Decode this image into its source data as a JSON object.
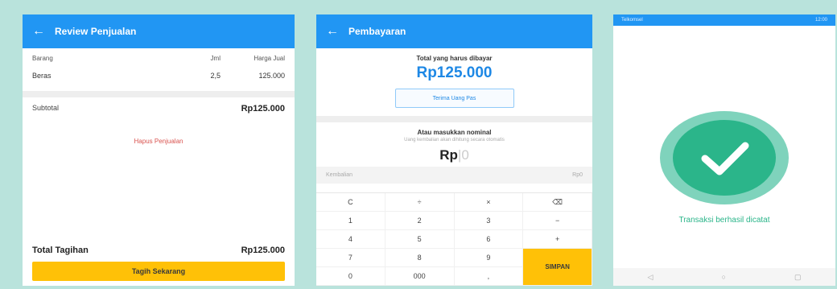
{
  "screen1": {
    "title": "Review Penjualan",
    "headers": {
      "item": "Barang",
      "qty": "Jml",
      "price": "Harga Jual"
    },
    "rows": [
      {
        "item": "Beras",
        "qty": "2,5",
        "price": "125.000"
      }
    ],
    "subtotal_label": "Subtotal",
    "subtotal_value": "Rp125.000",
    "delete_label": "Hapus Penjualan",
    "total_label": "Total Tagihan",
    "total_value": "Rp125.000",
    "charge_button": "Tagih Sekarang"
  },
  "screen2": {
    "title": "Pembayaran",
    "total_label": "Total yang harus dibayar",
    "total_value": "Rp125.000",
    "exact_cash_button": "Terima Uang Pas",
    "nominal_title": "Atau masukkan nominal",
    "nominal_hint": "Uang kembalian akan dihitung secara otomatis",
    "input_prefix": "Rp",
    "input_placeholder": "0",
    "change_label": "Kembalian",
    "change_value": "Rp0",
    "keys": [
      "C",
      "÷",
      "×",
      "⌫",
      "1",
      "2",
      "3",
      "−",
      "4",
      "5",
      "6",
      "+",
      "7",
      "8",
      "9",
      "0",
      "000",
      ","
    ],
    "save_button": "SIMPAN"
  },
  "screen3": {
    "status_left": "Telkomsel",
    "status_right": "12:00",
    "success_text": "Transaksi berhasil dicatat",
    "nav": [
      "◁",
      "○",
      "▢"
    ],
    "accent": "#2bb58a"
  }
}
